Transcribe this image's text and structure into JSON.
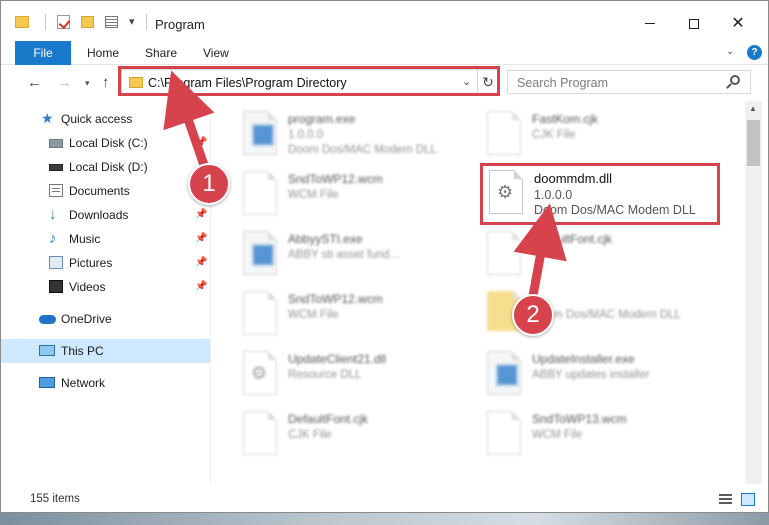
{
  "window": {
    "title": "Program"
  },
  "ribbon": {
    "tabs": [
      "File",
      "Home",
      "Share",
      "View"
    ]
  },
  "address": {
    "path": "C:\\Program Files\\Program Directory"
  },
  "search": {
    "placeholder": "Search Program"
  },
  "sidebar": {
    "items": [
      {
        "label": "Quick access",
        "icon": "star-icon",
        "pinned": false
      },
      {
        "label": "Local Disk (C:)",
        "icon": "drive-icon",
        "pinned": true
      },
      {
        "label": "Local Disk (D:)",
        "icon": "drive-icon",
        "pinned": false
      },
      {
        "label": "Documents",
        "icon": "documents-icon",
        "pinned": true
      },
      {
        "label": "Downloads",
        "icon": "download-icon",
        "pinned": true
      },
      {
        "label": "Music",
        "icon": "music-icon",
        "pinned": true
      },
      {
        "label": "Pictures",
        "icon": "pictures-icon",
        "pinned": true
      },
      {
        "label": "Videos",
        "icon": "video-icon",
        "pinned": true
      },
      {
        "label": "OneDrive",
        "icon": "cloud-icon",
        "pinned": false
      },
      {
        "label": "This PC",
        "icon": "pc-icon",
        "pinned": false,
        "selected": true
      },
      {
        "label": "Network",
        "icon": "network-icon",
        "pinned": false
      }
    ]
  },
  "files": [
    {
      "name": "program.exe",
      "line2": "1.0.0.0",
      "line3": "Doom Dos/MAC Modem DLL",
      "type": "exe",
      "blurred": true
    },
    {
      "name": "FastKom.cjk",
      "line2": "CJK File",
      "line3": "",
      "type": "doc",
      "blurred": true
    },
    {
      "name": "SndToWP12.wcm",
      "line2": "WCM File",
      "line3": "",
      "type": "doc",
      "blurred": true
    },
    {
      "name": "doommdm.dll",
      "line2": "1.0.0.0",
      "line3": "Doom Dos/MAC Modem DLL",
      "type": "dll",
      "blurred": false
    },
    {
      "name": "AbbyySTI.exe",
      "line2": "ABBY sti asset fund...",
      "line3": "",
      "type": "exe",
      "blurred": true
    },
    {
      "name": "DefaultFont.cjk",
      "line2": "",
      "line3": "",
      "type": "doc",
      "blurred": true
    },
    {
      "name": "SndToWP12.wcm",
      "line2": "WCM File",
      "line3": "",
      "type": "doc",
      "blurred": true
    },
    {
      "name": "",
      "line2": "Doom Dos/MAC Modem DLL",
      "line3": "",
      "type": "folder",
      "blurred": true
    },
    {
      "name": "UpdateClient21.dll",
      "line2": "Resource DLL",
      "line3": "",
      "type": "dll",
      "blurred": true
    },
    {
      "name": "UpdateInstaller.exe",
      "line2": "ABBY updates installer",
      "line3": "",
      "type": "exe",
      "blurred": true
    },
    {
      "name": "DefaultFont.cjk",
      "line2": "CJK File",
      "line3": "",
      "type": "doc",
      "blurred": true
    },
    {
      "name": "SndToWP13.wcm",
      "line2": "WCM File",
      "line3": "",
      "type": "doc",
      "blurred": true
    }
  ],
  "status": {
    "item_count": "155 items"
  },
  "annotations": {
    "badge1": "1",
    "badge2": "2",
    "color": "#d7434d"
  },
  "colors": {
    "accent": "#1979ca",
    "selected_bg": "#cde8ff"
  }
}
